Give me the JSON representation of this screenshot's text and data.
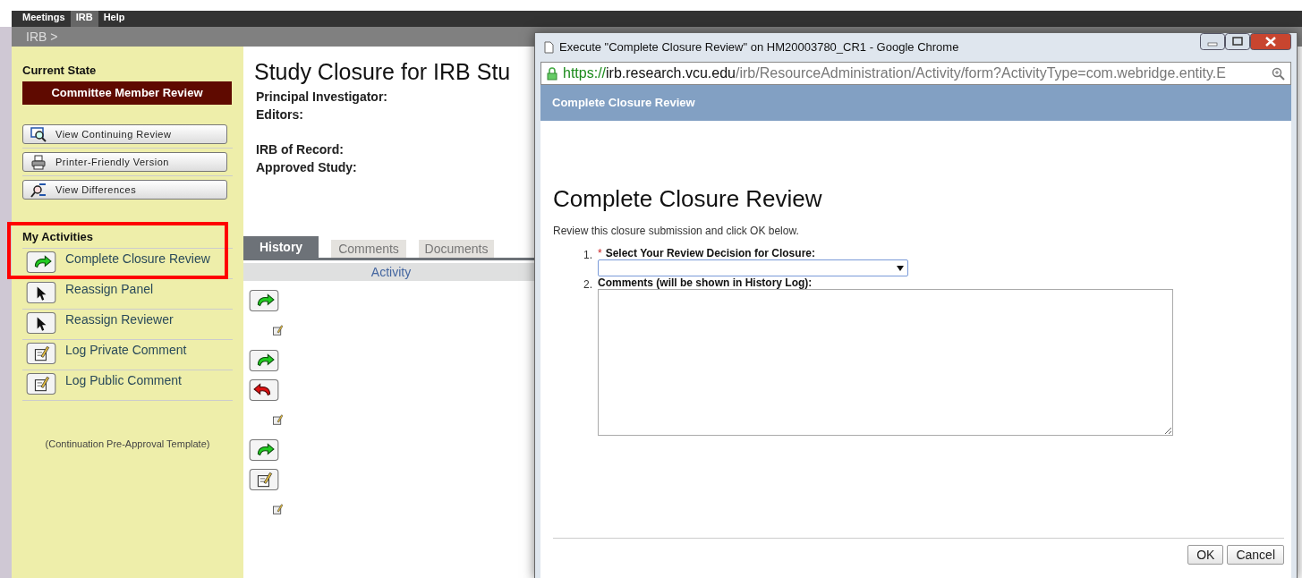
{
  "top_nav": [
    {
      "label": "Meetings",
      "selected": false
    },
    {
      "label": "IRB",
      "selected": true
    },
    {
      "label": "Help",
      "selected": false
    }
  ],
  "breadcrumb": "IRB >",
  "sidebar": {
    "current_state_label": "Current State",
    "current_state": "Committee Member Review",
    "buttons": [
      {
        "label": "View Continuing Review",
        "kind": "magnifier"
      },
      {
        "label": "Printer-Friendly Version",
        "kind": "printer"
      },
      {
        "label": "View Differences",
        "kind": "compare"
      }
    ],
    "activities_title": "My Activities",
    "activities": [
      {
        "label": "Complete Closure Review",
        "kind": "forward"
      },
      {
        "label": "Reassign Panel",
        "kind": "pointer"
      },
      {
        "label": "Reassign Reviewer",
        "kind": "pointer"
      },
      {
        "label": "Log Private Comment",
        "kind": "note"
      },
      {
        "label": "Log Public Comment",
        "kind": "note"
      }
    ],
    "template_note": "(Continuation Pre-Approval Template)"
  },
  "main": {
    "title": "Study Closure for IRB Stu",
    "field_groups": [
      [
        "Principal Investigator:",
        "Editors:"
      ],
      [
        "IRB of Record:",
        "Approved Study:"
      ]
    ],
    "tabs": [
      {
        "label": "History",
        "selected": true
      },
      {
        "label": "Comments",
        "selected": false
      },
      {
        "label": "Documents",
        "selected": false
      }
    ],
    "column": "Activity",
    "history_icons": [
      {
        "kind": "forward"
      },
      {
        "kind": "note-small"
      },
      {
        "kind": "forward"
      },
      {
        "kind": "return"
      },
      {
        "kind": "note-small"
      },
      {
        "kind": "forward"
      },
      {
        "kind": "note"
      },
      {
        "kind": "note-small"
      }
    ]
  },
  "popup": {
    "window_title": "Execute \"Complete Closure Review\" on HM20003780_CR1 - Google Chrome",
    "url_scheme": "https://",
    "url_host": "irb.research.vcu.edu",
    "url_path": "/irb/ResourceAdministration/Activity/form?ActivityType=com.webridge.entity.E",
    "header": "Complete Closure Review",
    "heading": "Complete Closure Review",
    "instructions": "Review this closure submission and click OK below.",
    "required_mark": "*",
    "questions": [
      {
        "number": "1.",
        "label": "Select Your Review Decision for Closure:",
        "required": true,
        "kind": "select"
      },
      {
        "number": "2.",
        "label": "Comments (will be shown in History Log):",
        "required": false,
        "kind": "textarea"
      }
    ],
    "buttons": [
      "OK",
      "Cancel"
    ]
  }
}
